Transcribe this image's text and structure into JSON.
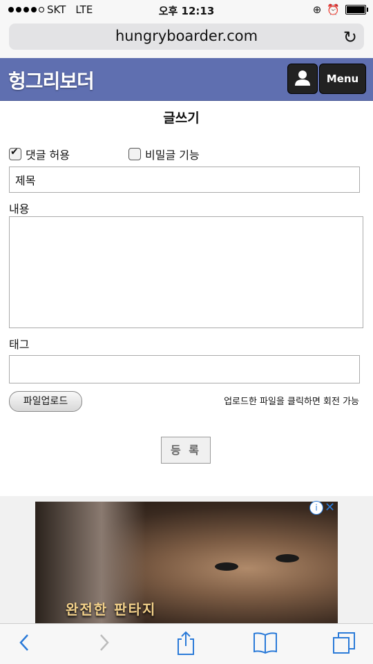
{
  "status_bar": {
    "carrier": "SKT",
    "network": "LTE",
    "time": "오후 12:13"
  },
  "browser": {
    "url": "hungryboarder.com"
  },
  "header": {
    "logo": "헝그리보더",
    "menu_label": "Menu"
  },
  "form": {
    "heading": "글쓰기",
    "allow_comments_label": "댓글 허용",
    "allow_comments_checked": true,
    "secret_post_label": "비밀글 기능",
    "secret_post_checked": false,
    "title_placeholder": "제목",
    "content_label": "내용",
    "tag_label": "태그",
    "upload_button": "파일업로드",
    "upload_hint": "업로드한 파일을 클릭하면 회전 가능",
    "submit_button": "등 록"
  },
  "ad": {
    "headline": "완전한 판타지",
    "info_icon": "info-icon",
    "close_icon": "close-icon"
  },
  "toolbar": {
    "icons": [
      "back-icon",
      "forward-icon",
      "share-icon",
      "bookmarks-icon",
      "tabs-icon"
    ]
  }
}
